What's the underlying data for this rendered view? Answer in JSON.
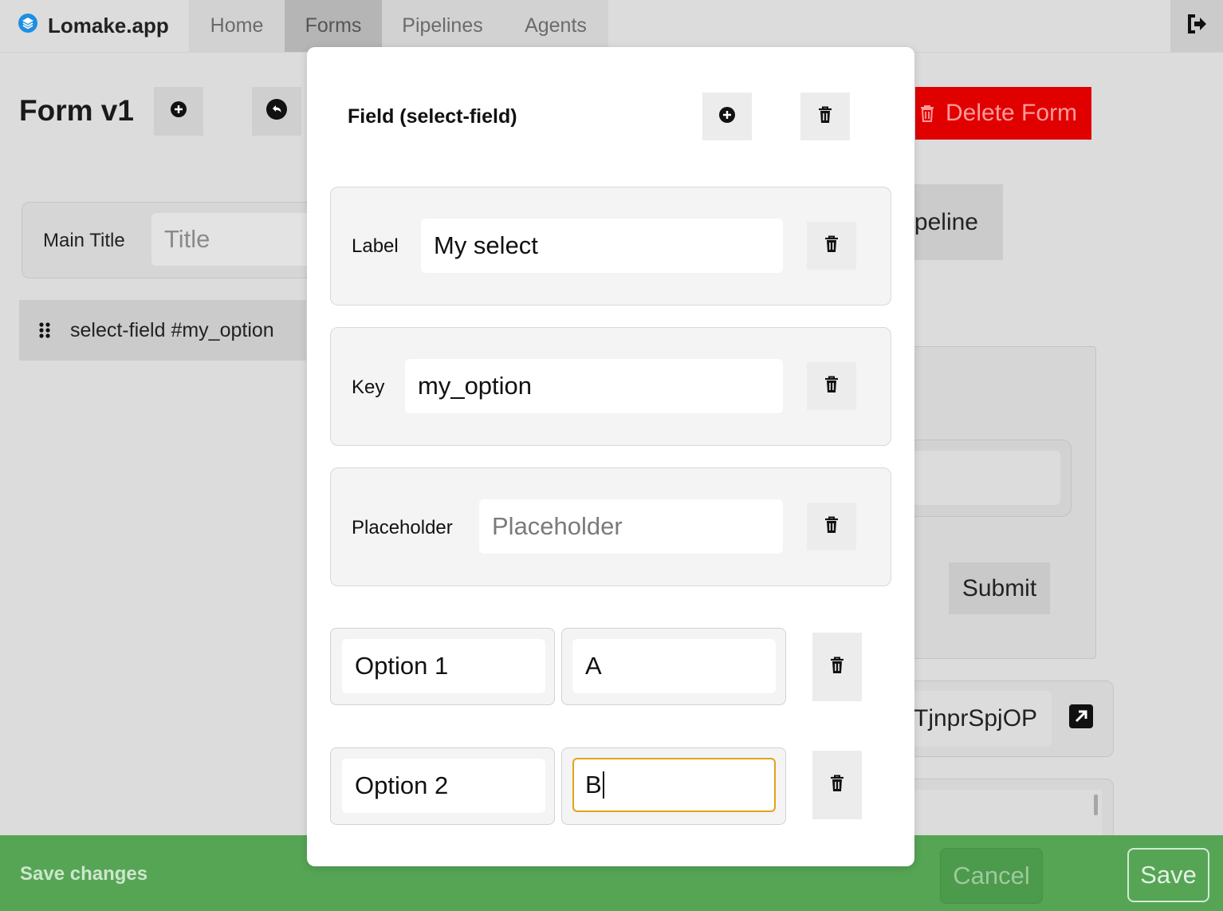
{
  "app": {
    "brand_name": "Lomake.app",
    "nav_tabs": [
      "Home",
      "Forms",
      "Pipelines",
      "Agents"
    ],
    "active_tab": "Forms"
  },
  "page": {
    "form_title": "Form v1",
    "main_title_label": "Main Title",
    "main_title_placeholder": "Title",
    "field_list": [
      {
        "label": "select-field #my_option"
      }
    ],
    "delete_form_label": "Delete Form",
    "pipeline_button_label": "peline",
    "preview": {
      "submit_label": "Submit"
    },
    "share_link_text": "TjnprSpjOP"
  },
  "modal": {
    "title": "Field (select-field)",
    "properties": [
      {
        "label": "Label",
        "value": "My select",
        "placeholder": ""
      },
      {
        "label": "Key",
        "value": "my_option",
        "placeholder": ""
      },
      {
        "label": "Placeholder",
        "value": "",
        "placeholder": "Placeholder"
      }
    ],
    "options": [
      {
        "label": "Option 1",
        "value": "A"
      },
      {
        "label": "Option 2",
        "value": "B"
      }
    ]
  },
  "savebar": {
    "label": "Save changes",
    "cancel_label": "Cancel",
    "save_label": "Save"
  },
  "colors": {
    "delete_button": "#e00000",
    "save_bar": "#55a555",
    "focus_ring": "#e3a317",
    "brand_icon": "#1e8fe0"
  },
  "icons": {
    "brand": "layers-icon",
    "logout": "logout-icon",
    "add": "plus-circle-icon",
    "undo": "undo-circle-icon",
    "drag": "drag-handle-icon",
    "delete": "trash-icon",
    "open_link": "external-link-icon"
  }
}
